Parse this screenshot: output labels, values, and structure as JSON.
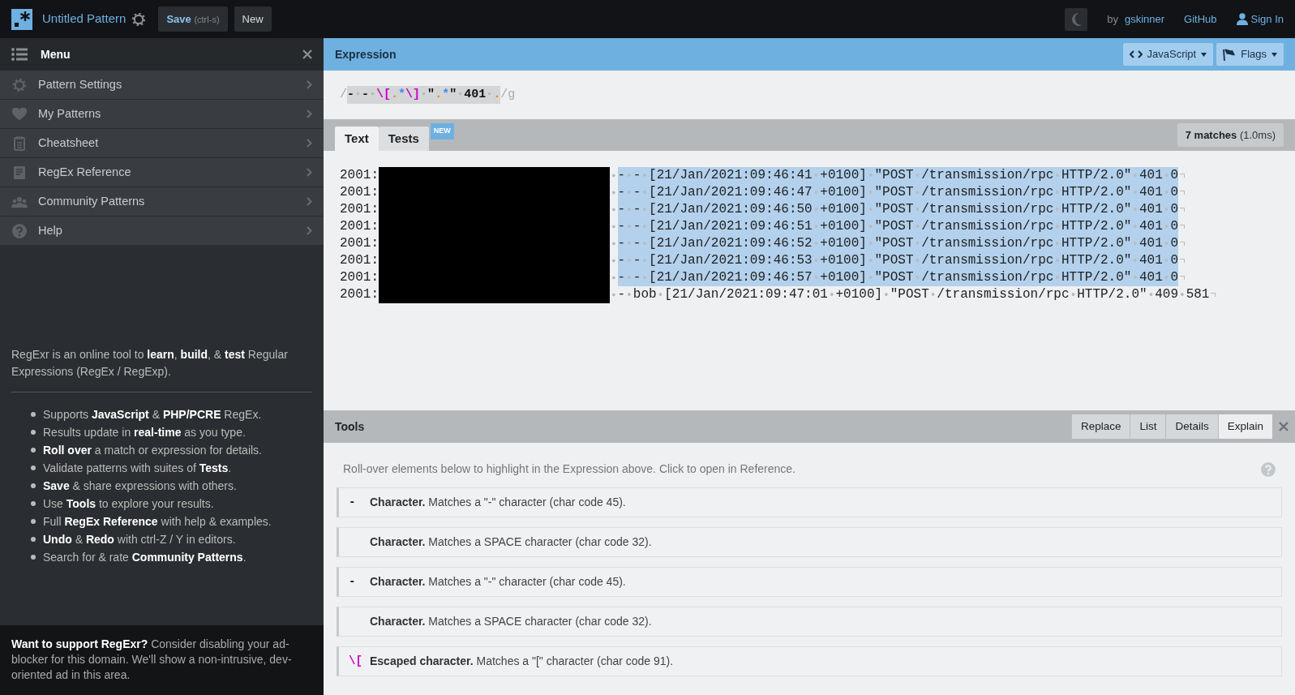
{
  "header": {
    "title": "Untitled Pattern",
    "save": {
      "label": "Save",
      "shortcut": "(ctrl-s)"
    },
    "new_button": "New",
    "by_prefix": "by",
    "author": "gskinner",
    "github": "GitHub",
    "sign_in": "Sign In"
  },
  "menu": {
    "title": "Menu",
    "items": [
      {
        "label": "Pattern Settings"
      },
      {
        "label": "My Patterns"
      },
      {
        "label": "Cheatsheet"
      },
      {
        "label": "RegEx Reference"
      },
      {
        "label": "Community Patterns"
      },
      {
        "label": "Help"
      }
    ]
  },
  "intro": {
    "text": "RegExr is an online tool to **learn**, **build**, & **test** Regular Expressions (RegEx / RegExp).",
    "features": [
      "Supports **JavaScript** & **PHP/PCRE** RegEx.",
      "Results update in **real-time** as you type.",
      "**Roll over** a match or expression for details.",
      "Validate patterns with suites of **Tests**.",
      "**Save** & share expressions with others.",
      "Use **Tools** to explore your results.",
      "Full **RegEx Reference** with help & examples.",
      "**Undo** & **Redo** with ctrl-Z / Y in editors.",
      "Search for & rate **Community Patterns**."
    ]
  },
  "ad": "**Want to support RegExr?** Consider disabling your ad-blocker for this domain. We'll show a non-intrusive, dev-oriented ad in this area.",
  "expression": {
    "title": "Expression",
    "flavor_button": "JavaScript",
    "flags_button": "Flags",
    "open": "/",
    "close": "/g",
    "tokens": [
      {
        "text": "-",
        "kind": "char"
      },
      {
        "kind": "space"
      },
      {
        "text": "-",
        "kind": "char"
      },
      {
        "kind": "space"
      },
      {
        "text": "\\[",
        "kind": "escape"
      },
      {
        "text": ".",
        "kind": "dot"
      },
      {
        "text": "*",
        "kind": "quant"
      },
      {
        "text": "\\]",
        "kind": "escape"
      },
      {
        "kind": "space"
      },
      {
        "text": "\"",
        "kind": "char"
      },
      {
        "text": ".",
        "kind": "dot"
      },
      {
        "text": "*",
        "kind": "quant"
      },
      {
        "text": "\"",
        "kind": "char"
      },
      {
        "kind": "space"
      },
      {
        "text": "401",
        "kind": "char"
      },
      {
        "kind": "space"
      },
      {
        "text": ".",
        "kind": "dot"
      }
    ]
  },
  "text_panel": {
    "tabs": [
      {
        "label": "Text",
        "selected": true
      },
      {
        "label": "Tests",
        "selected": false,
        "badge": "NEW"
      }
    ],
    "matches": "**7 matches** (1.0ms)",
    "lines": [
      {
        "prefix": "2001:",
        "text": "- - [21/Jan/2021:09:46:41 +0100] \"POST /transmission/rpc HTTP/2.0\" 401 0",
        "matched": true
      },
      {
        "prefix": "2001:",
        "text": "- - [21/Jan/2021:09:46:47 +0100] \"POST /transmission/rpc HTTP/2.0\" 401 0",
        "matched": true
      },
      {
        "prefix": "2001:",
        "text": "- - [21/Jan/2021:09:46:50 +0100] \"POST /transmission/rpc HTTP/2.0\" 401 0",
        "matched": true
      },
      {
        "prefix": "2001:",
        "text": "- - [21/Jan/2021:09:46:51 +0100] \"POST /transmission/rpc HTTP/2.0\" 401 0",
        "matched": true
      },
      {
        "prefix": "2001:",
        "text": "- - [21/Jan/2021:09:46:52 +0100] \"POST /transmission/rpc HTTP/2.0\" 401 0",
        "matched": true
      },
      {
        "prefix": "2001:",
        "text": "- - [21/Jan/2021:09:46:53 +0100] \"POST /transmission/rpc HTTP/2.0\" 401 0",
        "matched": true
      },
      {
        "prefix": "2001:",
        "text": "- - [21/Jan/2021:09:46:57 +0100] \"POST /transmission/rpc HTTP/2.0\" 401 0",
        "matched": true
      },
      {
        "prefix": "2001:",
        "text": "- bob [21/Jan/2021:09:47:01 +0100] \"POST /transmission/rpc HTTP/2.0\" 409 581",
        "matched": false
      }
    ]
  },
  "tools": {
    "title": "Tools",
    "tabs": [
      {
        "label": "Replace",
        "selected": false
      },
      {
        "label": "List",
        "selected": false
      },
      {
        "label": "Details",
        "selected": false
      },
      {
        "label": "Explain",
        "selected": true
      }
    ],
    "hint": "Roll-over elements below to highlight in the Expression above. Click to open in Reference.",
    "rows": [
      {
        "token": "-",
        "kind": "char",
        "text": "**Character.** Matches a \"-\" character (char code 45)."
      },
      {
        "text": "**Character.** Matches a SPACE character (char code 32)."
      },
      {
        "token": "-",
        "kind": "char",
        "text": "**Character.** Matches a \"-\" character (char code 45)."
      },
      {
        "text": "**Character.** Matches a SPACE character (char code 32)."
      },
      {
        "token": "\\[",
        "kind": "escape",
        "text": "**Escaped character.** Matches a \"[\" character (char code 91)."
      }
    ]
  }
}
